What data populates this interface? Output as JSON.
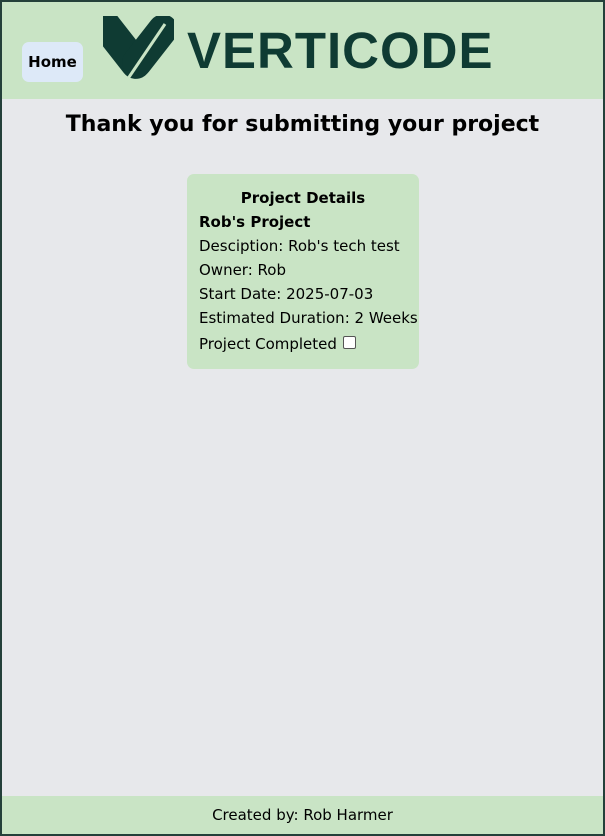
{
  "header": {
    "home_label": "Home",
    "logo_text": "VERTICODE",
    "logo_icon": "verticode-logo-icon",
    "brand_color": "#0f3b33"
  },
  "main": {
    "title": "Thank you for submitting your project"
  },
  "project": {
    "heading": "Project Details",
    "name": "Rob's Project",
    "description": "Desciption: Rob's tech test",
    "owner": "Owner: Rob",
    "start_date": "Start Date: 2025-07-03",
    "duration": "Estimated Duration: 2 Weeks",
    "completed_label": "Project Completed",
    "completed": false
  },
  "footer": {
    "text": "Created by: Rob Harmer"
  },
  "colors": {
    "header_bg": "#c9e4c5",
    "page_bg": "#e7e8eb",
    "home_button_bg": "#dde9f8"
  }
}
